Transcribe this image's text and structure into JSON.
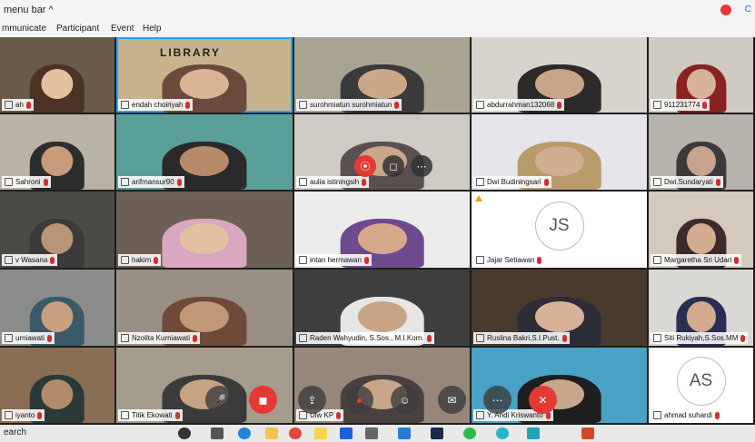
{
  "menubar": {
    "title": "menu bar ^",
    "cc_label": "C"
  },
  "menu": {
    "items": [
      "mmunicate",
      "Participant",
      "Event",
      "Help"
    ]
  },
  "participants": [
    {
      "name": "ah"
    },
    {
      "name": "endah choiriyah"
    },
    {
      "name": "surohmiatun surohmiatun"
    },
    {
      "name": "abdurrahman132068"
    },
    {
      "name": "911231774"
    },
    {
      "name": "Sahroni"
    },
    {
      "name": "arifmansur90"
    },
    {
      "name": "aulia istiningsih"
    },
    {
      "name": "Dwi Budiningsari"
    },
    {
      "name": "Dwi.Sundaryati"
    },
    {
      "name": "v Wasana"
    },
    {
      "name": "hakim"
    },
    {
      "name": "intan hermawan"
    },
    {
      "name": "Jajar Setiawan",
      "initials": "JS"
    },
    {
      "name": "Margaretha Sri Udari"
    },
    {
      "name": "urniawati"
    },
    {
      "name": "Nzolita Kurniawati"
    },
    {
      "name": "Raden Wahyudin, S.Sos., M.I.Kom."
    },
    {
      "name": "Ruslina Bakri,S.I.Pust."
    },
    {
      "name": "Siti Rukiyah,S.Sos.MM"
    },
    {
      "name": "iyanto"
    },
    {
      "name": "Titik Ekowati"
    },
    {
      "name": "Ulw KP"
    },
    {
      "name": "Y. Andi Kriswanto"
    },
    {
      "name": "ahmad suhardi",
      "initials": "AS"
    }
  ],
  "library_sign": "LIBRARY",
  "taskbar": {
    "search_label": "earch"
  }
}
